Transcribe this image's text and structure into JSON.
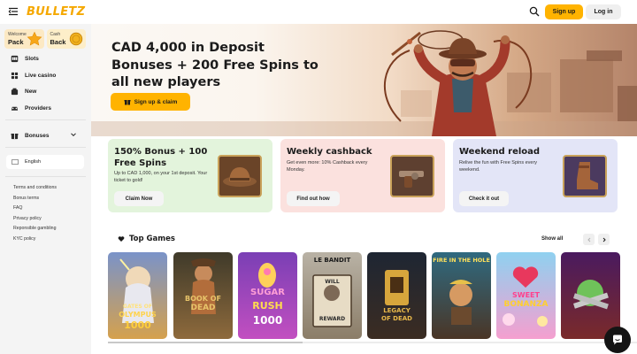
{
  "header": {
    "logo": "BULLETZ",
    "signup_label": "Sign up",
    "login_label": "Log in"
  },
  "sidebar": {
    "promo_tiles": [
      {
        "small": "Welcome",
        "big": "Pack"
      },
      {
        "small": "Cash",
        "big": "Back"
      }
    ],
    "nav": [
      {
        "label": "Slots",
        "icon": "slots-icon"
      },
      {
        "label": "Live casino",
        "icon": "live-casino-icon"
      },
      {
        "label": "New",
        "icon": "new-icon"
      },
      {
        "label": "Providers",
        "icon": "providers-icon"
      },
      {
        "label": "Bonuses",
        "icon": "bonuses-icon"
      }
    ],
    "language": "English",
    "footer_links": [
      "Terms and conditions",
      "Bonus terms",
      "FAQ",
      "Privacy policy",
      "Reponsible gambling",
      "KYC policy"
    ]
  },
  "hero": {
    "title": "CAD 4,000 in Deposit Bonuses + 200 Free Spins to all new players",
    "cta": "Sign up & claim"
  },
  "promos": [
    {
      "title": "150% Bonus + 100 Free Spins",
      "desc": "Up to CAD 1,000, on your 1st deposit. Your ticket to gold!",
      "button": "Claim Now"
    },
    {
      "title": "Weekly cashback",
      "desc": "Get even more: 10% Cashback every Monday.",
      "button": "Find out how"
    },
    {
      "title": "Weekend reload",
      "desc": "Relive the fun with Free Spins every weekend.",
      "button": "Check it out"
    }
  ],
  "top_games": {
    "title": "Top Games",
    "show_all": "Show all",
    "games": [
      {
        "label_top": "GATES OF",
        "label_mid": "OLYMPUS",
        "label_bot": "1000"
      },
      {
        "label_top": "",
        "label_mid": "BOOK OF",
        "label_bot": "DEAD"
      },
      {
        "label_top": "SUGAR",
        "label_mid": "RUSH",
        "label_bot": "1000"
      },
      {
        "label_top": "LE BANDIT",
        "label_mid": "WILL",
        "label_bot": "REWARD"
      },
      {
        "label_top": "",
        "label_mid": "LEGACY",
        "label_bot": "OF DEAD"
      },
      {
        "label_top": "FIRE IN THE HOLE",
        "label_mid": "",
        "label_bot": ""
      },
      {
        "label_top": "SWEET",
        "label_mid": "BONANZA",
        "label_bot": ""
      },
      {
        "label_top": "",
        "label_mid": "",
        "label_bot": ""
      }
    ]
  },
  "colors": {
    "accent": "#ffb300",
    "sidebar_bg": "#f4f4f4",
    "card_green": "#e3f4dc",
    "card_pink": "#fbe1de",
    "card_lilac": "#e3e5f7"
  }
}
